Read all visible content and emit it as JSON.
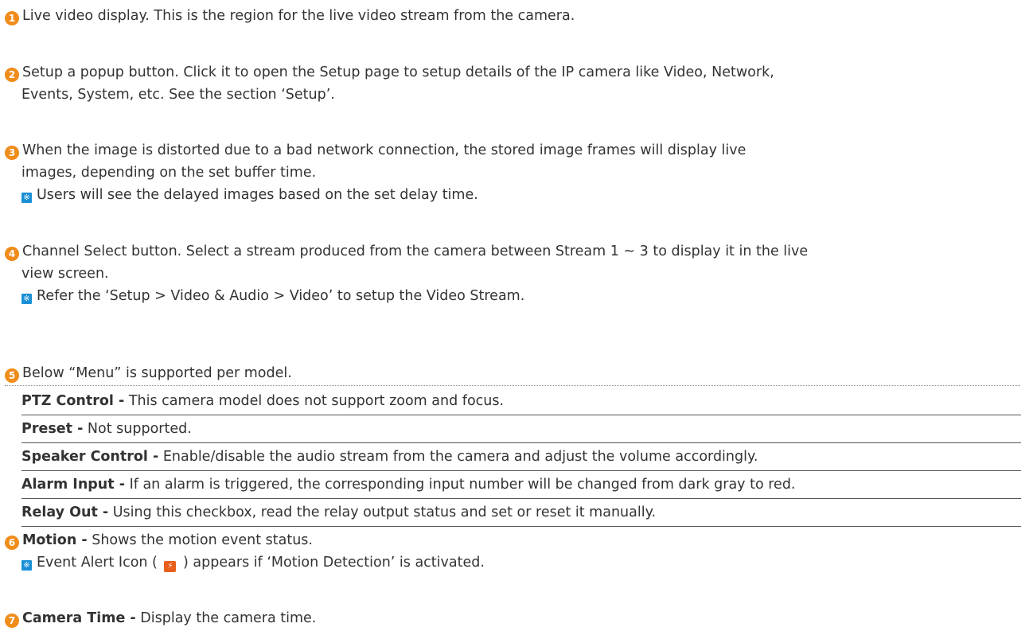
{
  "items": [
    {
      "number": "1",
      "lines": [
        "Live video display. This is the region for the live video stream from the camera."
      ]
    },
    {
      "number": "2",
      "lines": [
        "Setup a popup button. Click it to open the Setup page to setup details of the IP camera like Video, Network,",
        "Events, System, etc. See the section ‘Setup’."
      ]
    },
    {
      "number": "3",
      "lines": [
        "When the image is distorted due to a bad network connection, the stored image frames will display live",
        "images, depending on the set buffer time."
      ],
      "note": "Users will see the delayed images based on the set delay time."
    },
    {
      "number": "4",
      "lines": [
        "Channel Select button. Select a stream produced from the camera between Stream 1 ~ 3 to display it in the live",
        "view screen."
      ],
      "note": "Refer the ‘Setup > Video & Audio > Video’ to setup the Video Stream."
    },
    {
      "number": "5",
      "text": "Below “Menu” is supported per model."
    },
    {
      "number": "6",
      "title": "Motion -",
      "text": "Shows the motion event status.",
      "note_before": "Event Alert Icon (",
      "note_after": ") appears if ‘Motion Detection’ is activated.",
      "alert_icon": "event-alert-icon"
    },
    {
      "number": "7",
      "title": "Camera Time -",
      "text": "Display the camera time."
    }
  ],
  "menu": [
    {
      "title": "PTZ Control -",
      "text": "This camera model does not support zoom and focus."
    },
    {
      "title": "Preset -",
      "text": "Not supported."
    },
    {
      "title": "Speaker Control -",
      "text": "Enable/disable the audio stream from the camera and adjust the volume accordingly."
    },
    {
      "title": "Alarm Input -",
      "text": "If an alarm is triggered, the corresponding input number will be changed from dark gray to red."
    },
    {
      "title": "Relay Out -",
      "text": "Using this checkbox, read the relay output status and set or reset it manually."
    }
  ],
  "colors": {
    "number_badge": "#f08c1a",
    "note_icon": "#1a8fd6",
    "alert_icon": "#e8601c",
    "text": "#333333"
  }
}
